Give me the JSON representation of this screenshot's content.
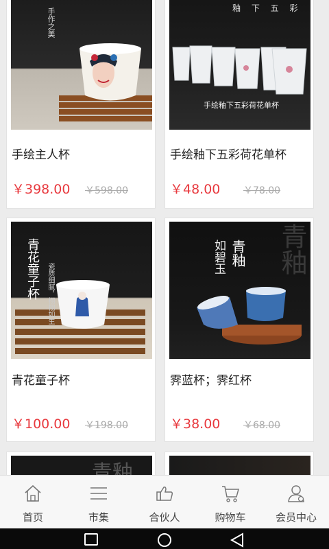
{
  "products": [
    {
      "name": "手绘主人杯",
      "price": "￥398.00",
      "orig": "￥598.00"
    },
    {
      "name": "手绘釉下五彩荷花单杯",
      "price": "￥48.00",
      "orig": "￥78.00"
    },
    {
      "name": "青花童子杯",
      "price": "￥100.00",
      "orig": "￥198.00"
    },
    {
      "name": "霁蓝杯；霁红杯",
      "price": "￥38.00",
      "orig": "￥68.00"
    }
  ],
  "image_text": {
    "p1_side": "手作之美",
    "p2_caption": "手绘釉下五彩荷花单杯",
    "p2_top": "釉 下 五 彩",
    "p3_title": "青花童子杯",
    "p3_sub": "瓷质细腻，栩栩如生",
    "p4_title1": "青釉",
    "p4_title2": "如碧玉",
    "p4_bg": "青釉",
    "p5_bg": "青釉"
  },
  "tabs": [
    {
      "label": "首页",
      "icon": "home-icon"
    },
    {
      "label": "市集",
      "icon": "list-icon"
    },
    {
      "label": "合伙人",
      "icon": "thumbs-up-icon"
    },
    {
      "label": "购物车",
      "icon": "cart-icon"
    },
    {
      "label": "会员中心",
      "icon": "user-icon"
    }
  ],
  "colors": {
    "price": "#e8393e",
    "tab_text": "#444444"
  }
}
